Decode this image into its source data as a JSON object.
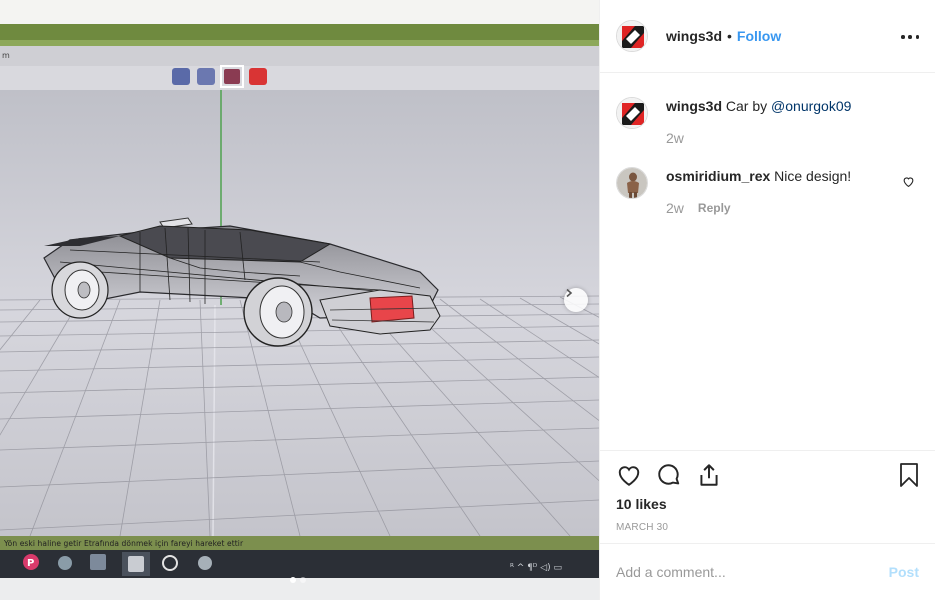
{
  "post": {
    "author": "wings3d",
    "header_separator": "•",
    "follow_label": "Follow",
    "more_icon": "more-options-icon",
    "caption": {
      "user": "wings3d",
      "text": "Car by ",
      "mention": "@onurgok09",
      "time": "2w"
    },
    "comments": [
      {
        "user": "osmiridium_rex",
        "text": "Nice design!",
        "time": "2w",
        "reply_label": "Reply"
      }
    ],
    "likes": "10 likes",
    "date": "MARCH 30",
    "comment_placeholder": "Add a comment...",
    "post_label": "Post"
  },
  "photo": {
    "status_text": "Yön eski haline getir   Etrafında dönmek için fareyi hareket ettir",
    "slide_count": 2,
    "active_slide": 0
  },
  "colors": {
    "accent": "#3897f0",
    "mention": "#003569",
    "muted": "#999999",
    "post_disabled": "#b2dffc",
    "tail_light": "#e8454a"
  }
}
